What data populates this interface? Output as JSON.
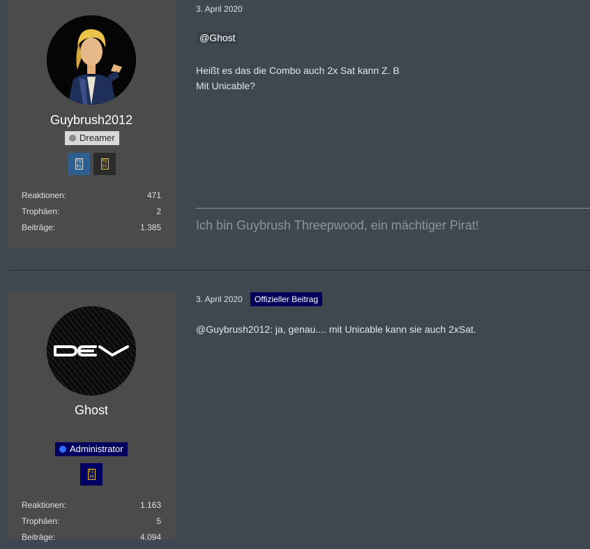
{
  "posts": [
    {
      "author": "Guybrush2012",
      "rank": "Dreamer",
      "trophies": [
        {
          "icon": "trophy-badge-icon",
          "text": "FO 91"
        },
        {
          "icon": "trophy-badge-icon",
          "text": "FO 91"
        }
      ],
      "stats": [
        {
          "label": "Reaktionen:",
          "value": "471"
        },
        {
          "label": "Trophäen:",
          "value": "2"
        },
        {
          "label": "Beiträge:",
          "value": "1.385"
        }
      ],
      "date": "3. April 2020",
      "mention": "@Ghost",
      "lines": [
        "Heißt es das die Combo auch 2x Sat kann Z. B",
        "Mit Unicable?"
      ],
      "signature": "Ich bin Guybrush Threepwood, ein mächtiger Pirat!"
    },
    {
      "author": "Ghost",
      "rank": "Administrator",
      "avatar_text": "dev",
      "trophies": [
        {
          "icon": "trophy-badge-icon",
          "text": "FI 30"
        }
      ],
      "stats": [
        {
          "label": "Reaktionen:",
          "value": "1.163"
        },
        {
          "label": "Trophäen:",
          "value": "5"
        },
        {
          "label": "Beiträge:",
          "value": "4.094"
        }
      ],
      "date": "3. April 2020",
      "official_label": "Offizieller Beitrag",
      "lines": [
        "@Guybrush2012: ja, genau.... mit Unicable kann sie auch 2xSat."
      ]
    }
  ],
  "colors": {
    "background": "#3f4750",
    "sidebar": "#4b4b4b",
    "admin_badge": "#00005c",
    "dreamer_badge": "#d8d8d8"
  }
}
